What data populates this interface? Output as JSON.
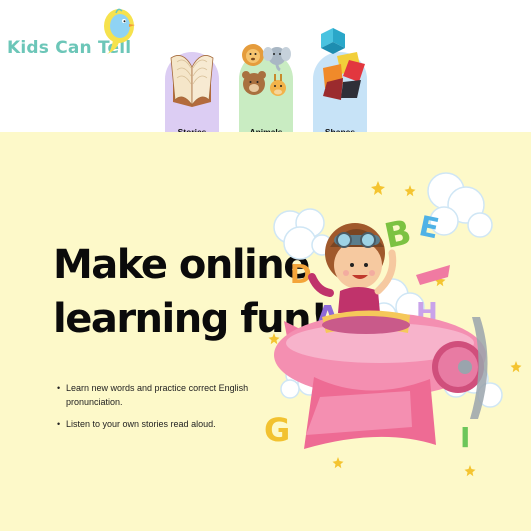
{
  "brand": {
    "name": "Kids Can Tell",
    "colors": {
      "logo_text": "#6cc6b8",
      "bird": "#8fd3f4",
      "hero_bg": "#fdf9c9"
    }
  },
  "categories": [
    {
      "label": "Stories",
      "icon": "open-book-icon",
      "color": "#dccdf3"
    },
    {
      "label": "Animals",
      "icon": "animal-faces-icon",
      "color": "#c9ecc2"
    },
    {
      "label": "Shapes",
      "icon": "3d-shapes-icon",
      "color": "#c7e3f7"
    }
  ],
  "hero": {
    "headline_line1": "Make online",
    "headline_line2": "learning fun!",
    "bullets": [
      "Learn new words and practice correct English pronunciation.",
      "Listen to your own stories read aloud."
    ],
    "illustration_letters": [
      "B",
      "E",
      "D",
      "A",
      "H",
      "F",
      "G",
      "I"
    ]
  }
}
